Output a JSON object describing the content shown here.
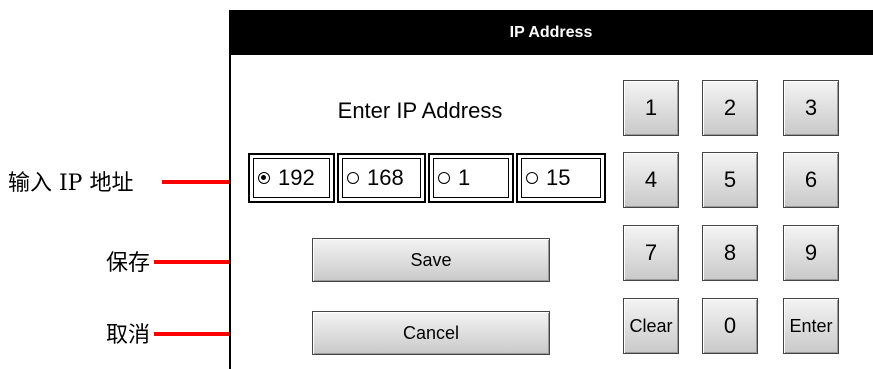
{
  "annotations": {
    "ip_input": "输入 IP 地址",
    "save": "保存",
    "cancel": "取消",
    "arrow_color": "#ff0000"
  },
  "dialog": {
    "title": "IP Address",
    "prompt": "Enter IP Address",
    "octets": [
      {
        "value": "192",
        "selected": true
      },
      {
        "value": "168",
        "selected": false
      },
      {
        "value": "1",
        "selected": false
      },
      {
        "value": "15",
        "selected": false
      }
    ],
    "save_label": "Save",
    "cancel_label": "Cancel"
  },
  "keypad": {
    "keys": [
      "1",
      "2",
      "3",
      "4",
      "5",
      "6",
      "7",
      "8",
      "9",
      "Clear",
      "0",
      "Enter"
    ]
  }
}
